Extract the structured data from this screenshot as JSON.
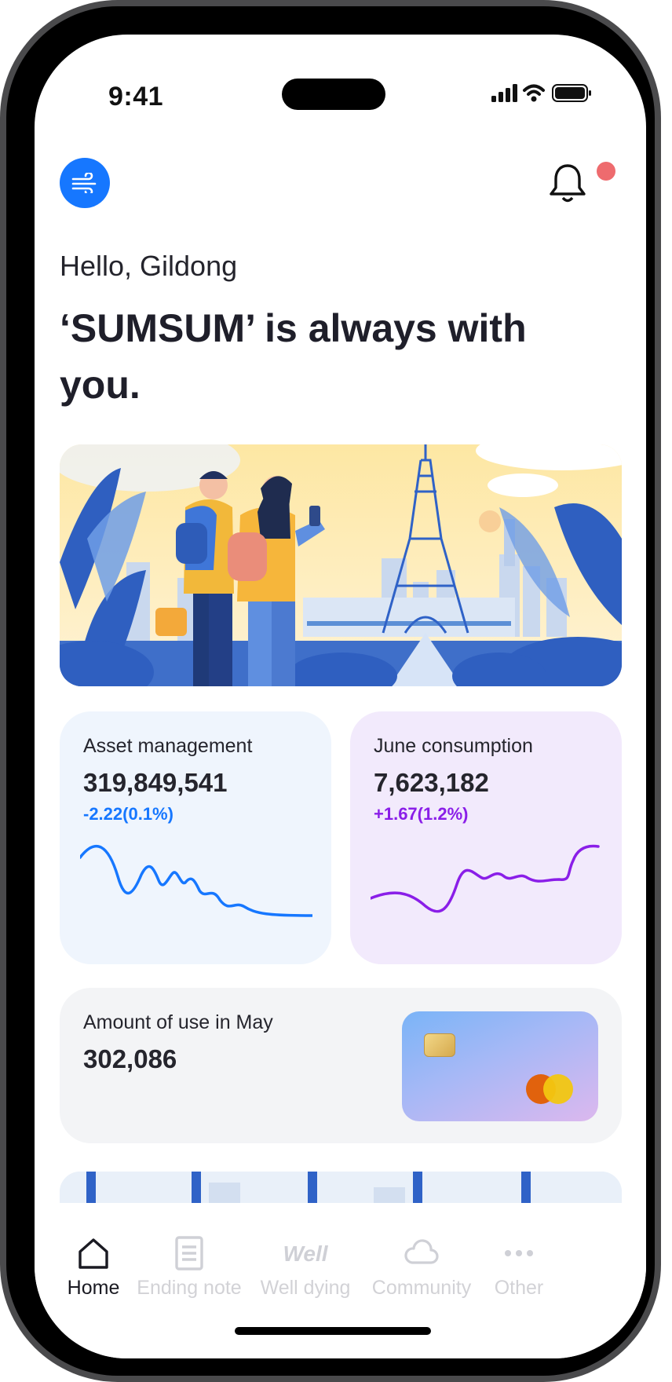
{
  "status_bar": {
    "time": "9:41"
  },
  "header": {
    "menu_icon": "wind-icon",
    "notification_icon": "bell-icon",
    "has_unread": true
  },
  "greeting": "Hello, Gildong",
  "headline": "‘SUMSUM’ is always with you.",
  "banner": {
    "image": "travel-couple-eiffel-tower-illustration"
  },
  "cards": {
    "asset": {
      "title": "Asset management",
      "value": "319,849,541",
      "change": "-2.22(0.1%)",
      "color": "#1677ff"
    },
    "consumption": {
      "title": "June consumption",
      "value": "7,623,182",
      "change": "+1.67(1.2%)",
      "color": "#8a1ee8"
    }
  },
  "usage": {
    "title": "Amount of use in May",
    "value": "302,086"
  },
  "tabs": [
    {
      "label": "Home",
      "icon": "home-icon",
      "active": true
    },
    {
      "label": "Ending note",
      "icon": "note-icon",
      "active": false
    },
    {
      "label": "Well dying",
      "icon": "well-icon",
      "icon_text": "Well",
      "active": false
    },
    {
      "label": "Community",
      "icon": "cloud-icon",
      "active": false
    },
    {
      "label": "Other",
      "icon": "more-icon",
      "active": false
    }
  ]
}
